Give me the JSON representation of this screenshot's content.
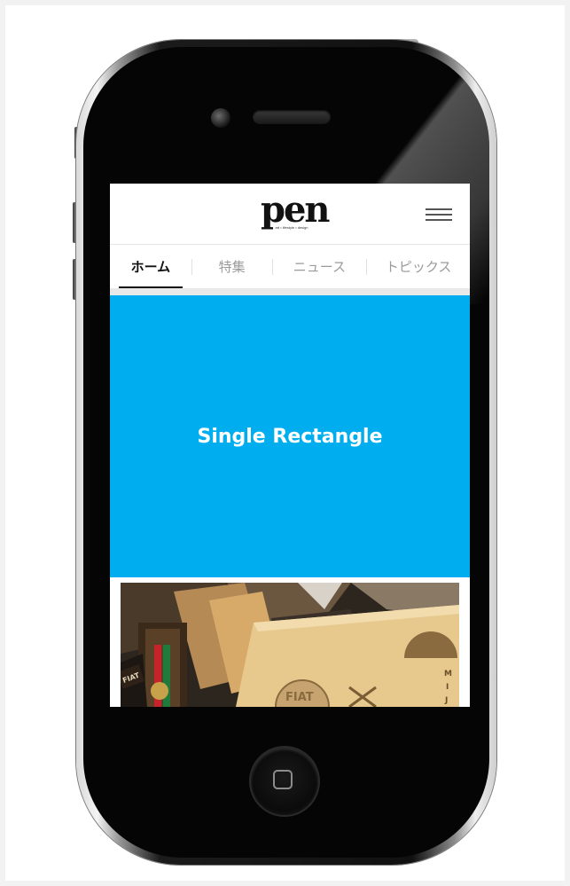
{
  "site": {
    "logo": "pen",
    "logo_tagline": "art • lifestyle • design"
  },
  "nav": {
    "tabs": [
      {
        "label": "ホーム",
        "active": true
      },
      {
        "label": "特集",
        "active": false
      },
      {
        "label": "ニュース",
        "active": false
      },
      {
        "label": "トピックス",
        "active": false
      }
    ]
  },
  "ad": {
    "label": "Single Rectangle",
    "color": "#00aeef"
  },
  "article": {
    "image_text_1": "FIAT",
    "image_text_2": "FIAT",
    "image_text_3": "M",
    "image_text_4": "I",
    "image_text_5": "J"
  },
  "colors": {
    "tab_active": "#111111",
    "tab_inactive": "#9b9b9b",
    "ad_background": "#00aeef"
  },
  "icons": {
    "menu": "hamburger-icon",
    "home": "home-square-icon"
  }
}
